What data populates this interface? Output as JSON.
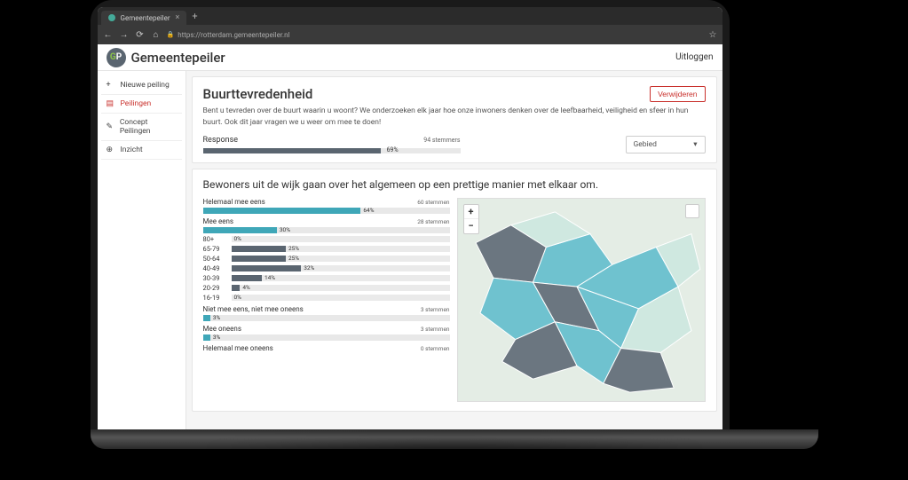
{
  "browser": {
    "tab_title": "Gemeentepeiler",
    "url": "https://rotterdam.gemeentepeiler.nl"
  },
  "header": {
    "logo_text": "GP",
    "brand": "Gemeentepeiler",
    "logout": "Uitloggen"
  },
  "sidebar": {
    "items": [
      {
        "icon": "+",
        "label": "Nieuwe peiling"
      },
      {
        "icon": "▤",
        "label": "Peilingen"
      },
      {
        "icon": "✎",
        "label": "Concept Peilingen"
      },
      {
        "icon": "⊕",
        "label": "Inzicht"
      }
    ]
  },
  "poll": {
    "title": "Buurttevredenheid",
    "delete_label": "Verwijderen",
    "description": "Bent u tevreden over de buurt waarin u woont? We onderzoeken elk jaar hoe onze inwoners denken over de leefbaarheid, veiligheid en sfeer in hun buurt. Ook dit jaar vragen we u weer om mee te doen!",
    "response_label": "Response",
    "response_pct": "69%",
    "response_stemmers": "94 stemmers",
    "region_select": "Gebied"
  },
  "question": {
    "title": "Bewoners uit de wijk gaan over het algemeen op een prettige manier met elkaar om.",
    "answers": [
      {
        "label": "Helemaal mee eens",
        "stemmen": "60 stemmen",
        "pct": "64%",
        "pct_val": 64
      },
      {
        "label": "Mee eens",
        "stemmen": "28 stemmen",
        "pct": "30%",
        "pct_val": 30
      },
      {
        "label": "Niet mee eens, niet mee oneens",
        "stemmen": "3 stemmen",
        "pct": "3%",
        "pct_val": 3
      },
      {
        "label": "Mee oneens",
        "stemmen": "3 stemmen",
        "pct": "3%",
        "pct_val": 3
      },
      {
        "label": "Helemaal mee oneens",
        "stemmen": "0 stemmen",
        "pct": "0%",
        "pct_val": 0
      }
    ],
    "age_breakdown": [
      {
        "label": "80+",
        "pct": "0%",
        "pct_val": 0
      },
      {
        "label": "65-79",
        "pct": "25%",
        "pct_val": 25
      },
      {
        "label": "50-64",
        "pct": "25%",
        "pct_val": 25
      },
      {
        "label": "40-49",
        "pct": "32%",
        "pct_val": 32
      },
      {
        "label": "30-39",
        "pct": "14%",
        "pct_val": 14
      },
      {
        "label": "20-29",
        "pct": "4%",
        "pct_val": 4
      },
      {
        "label": "16-19",
        "pct": "0%",
        "pct_val": 0
      }
    ]
  },
  "map": {
    "zoom_in": "+",
    "zoom_out": "−"
  },
  "chart_data": [
    {
      "type": "bar",
      "title": "Response",
      "categories": [
        "Response"
      ],
      "values": [
        69
      ],
      "unit": "%",
      "meta": {
        "stemmers": 94
      }
    },
    {
      "type": "bar",
      "title": "Bewoners uit de wijk gaan over het algemeen op een prettige manier met elkaar om.",
      "categories": [
        "Helemaal mee eens",
        "Mee eens",
        "Niet mee eens, niet mee oneens",
        "Mee oneens",
        "Helemaal mee oneens"
      ],
      "values": [
        64,
        30,
        3,
        3,
        0
      ],
      "counts": [
        60,
        28,
        3,
        3,
        0
      ],
      "unit": "%",
      "xlabel": "",
      "ylabel": ""
    },
    {
      "type": "bar",
      "title": "Mee eens — leeftijdsverdeling",
      "categories": [
        "80+",
        "65-79",
        "50-64",
        "40-49",
        "30-39",
        "20-29",
        "16-19"
      ],
      "values": [
        0,
        25,
        25,
        32,
        14,
        4,
        0
      ],
      "unit": "%"
    }
  ]
}
